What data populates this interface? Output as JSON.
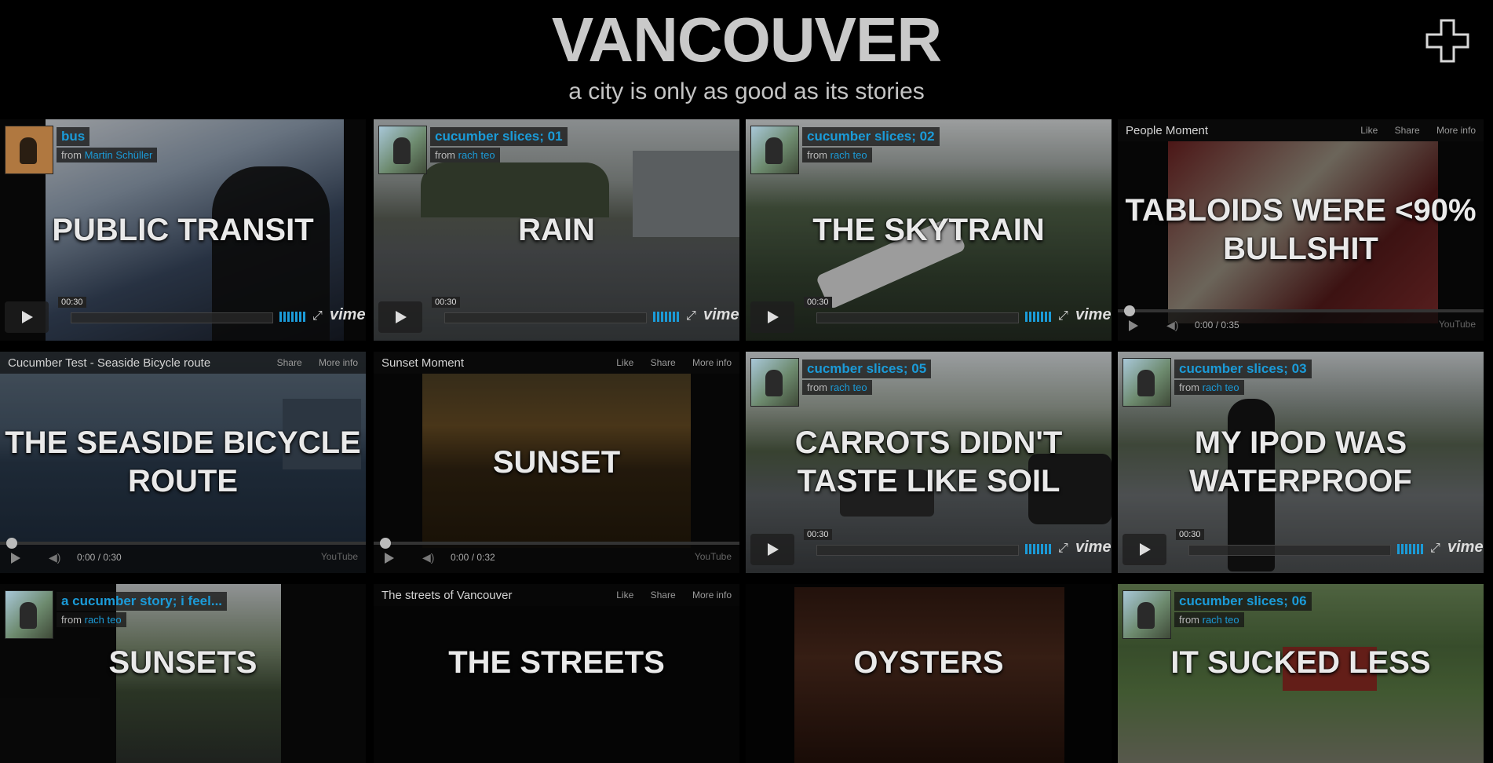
{
  "header": {
    "title": "VANCOUVER",
    "tagline": "a city is only as good as its stories",
    "add_icon": "plus-icon"
  },
  "tiles": [
    {
      "story": "PUBLIC TRANSIT",
      "player": "vimeo",
      "video_title": "bus",
      "from_label": "from",
      "author": "Martin Schüller",
      "time": "00:30"
    },
    {
      "story": "RAIN",
      "player": "vimeo",
      "video_title": "cucumber slices; 01",
      "from_label": "from",
      "author": "rach teo",
      "time": "00:30"
    },
    {
      "story": "THE SKYTRAIN",
      "player": "vimeo",
      "video_title": "cucumber slices; 02",
      "from_label": "from",
      "author": "rach teo",
      "time": "00:30"
    },
    {
      "story": "TABLOIDS WERE <90% BULLSHIT",
      "player": "youtube",
      "video_title": "People Moment",
      "time": "0:00 / 0:35"
    },
    {
      "story": "THE SEASIDE BICYCLE ROUTE",
      "player": "youtube",
      "video_title": "Cucumber Test - Seaside Bicycle route",
      "time": "0:00 / 0:30"
    },
    {
      "story": "SUNSET",
      "player": "youtube",
      "video_title": "Sunset Moment",
      "time": "0:00 / 0:32"
    },
    {
      "story": "CARROTS DIDN'T TASTE LIKE SOIL",
      "player": "vimeo",
      "video_title": "cucmber slices; 05",
      "from_label": "from",
      "author": "rach teo",
      "time": "00:30"
    },
    {
      "story": "MY IPOD WAS WATERPROOF",
      "player": "vimeo",
      "video_title": "cucumber slices; 03",
      "from_label": "from",
      "author": "rach teo",
      "time": "00:30"
    },
    {
      "story": "SUNSETS",
      "player": "vimeo",
      "video_title": "a cucumber story; i feel...",
      "from_label": "from",
      "author": "rach teo"
    },
    {
      "story": "THE STREETS",
      "player": "youtube",
      "video_title": "The streets of Vancouver"
    },
    {
      "story": "OYSTERS",
      "player": "none"
    },
    {
      "story": "IT SUCKED LESS",
      "player": "vimeo",
      "video_title": "cucumber slices; 06",
      "from_label": "from",
      "author": "rach teo"
    }
  ],
  "youtube_actions": {
    "like": "Like",
    "share": "Share",
    "more": "More info"
  },
  "vimeo_logo": "vimeo",
  "youtube_logo": "YouTube",
  "colors": {
    "background": "#000000",
    "link": "#1b9bd8",
    "title": "#c9c9c9"
  }
}
